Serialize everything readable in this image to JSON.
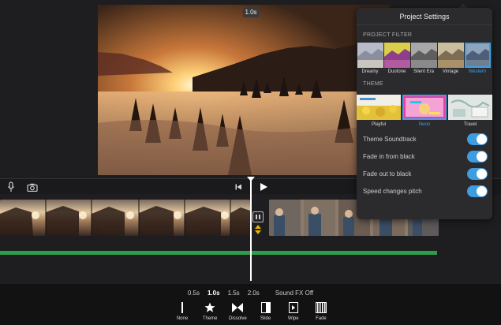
{
  "preview": {
    "time_badge": "1.0s"
  },
  "settings": {
    "title": "Project Settings",
    "filter_section": "PROJECT FILTER",
    "filters": [
      {
        "label": "Dreamy",
        "tint": "#a9a9b8"
      },
      {
        "label": "Duotone",
        "tint": "#b8b24a"
      },
      {
        "label": "Silent Era",
        "tint": "#8a8a8a"
      },
      {
        "label": "Vintage",
        "tint": "#c4b07a"
      },
      {
        "label": "Western",
        "tint": "#6f88a3"
      }
    ],
    "selected_filter": "Western",
    "theme_section": "THEME",
    "themes": [
      {
        "label": "Playful"
      },
      {
        "label": "Neon"
      },
      {
        "label": "Travel"
      }
    ],
    "selected_theme": "Neon",
    "toggles": [
      {
        "label": "Theme Soundtrack",
        "on": true
      },
      {
        "label": "Fade in from black",
        "on": true
      },
      {
        "label": "Fade out to black",
        "on": true
      },
      {
        "label": "Speed changes pitch",
        "on": true
      }
    ]
  },
  "timeline": {
    "durations": [
      "0.5s",
      "1.0s",
      "1.5s",
      "2.0s"
    ],
    "selected_duration": "1.0s",
    "sound_fx": "Sound FX Off"
  },
  "transitions": [
    {
      "label": "None",
      "icon": "none-icon"
    },
    {
      "label": "Theme",
      "icon": "star-icon"
    },
    {
      "label": "Dissolve",
      "icon": "dissolve-icon"
    },
    {
      "label": "Slide",
      "icon": "slide-icon"
    },
    {
      "label": "Wipe",
      "icon": "wipe-icon"
    },
    {
      "label": "Fade",
      "icon": "fade-icon"
    }
  ],
  "colors": {
    "accent": "#3da0e5",
    "audio_track": "#2e9c4a",
    "trim_arrows": "#e8b400"
  }
}
